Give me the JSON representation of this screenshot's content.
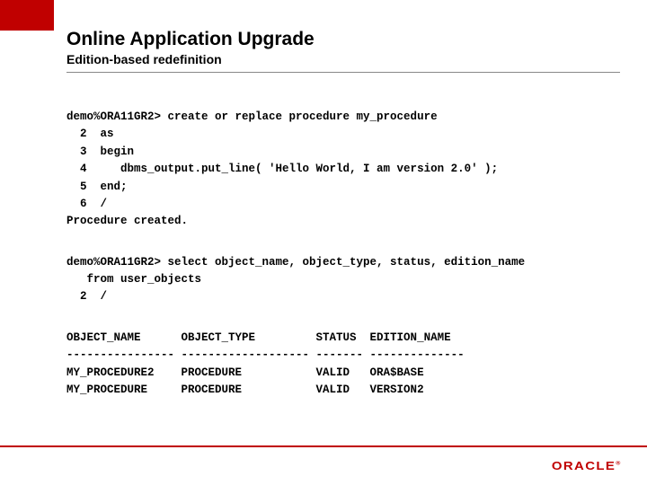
{
  "header": {
    "title": "Online Application Upgrade",
    "subtitle": "Edition-based redefinition"
  },
  "code1": "demo%ORA11GR2> create or replace procedure my_procedure\n  2  as\n  3  begin\n  4     dbms_output.put_line( 'Hello World, I am version 2.0' );\n  5  end;\n  6  /\nProcedure created.",
  "code2": "demo%ORA11GR2> select object_name, object_type, status, edition_name\n   from user_objects\n  2  /",
  "code3": "OBJECT_NAME      OBJECT_TYPE         STATUS  EDITION_NAME\n---------------- ------------------- ------- --------------\nMY_PROCEDURE2    PROCEDURE           VALID   ORA$BASE\nMY_PROCEDURE     PROCEDURE           VALID   VERSION2",
  "logo": "ORACLE"
}
